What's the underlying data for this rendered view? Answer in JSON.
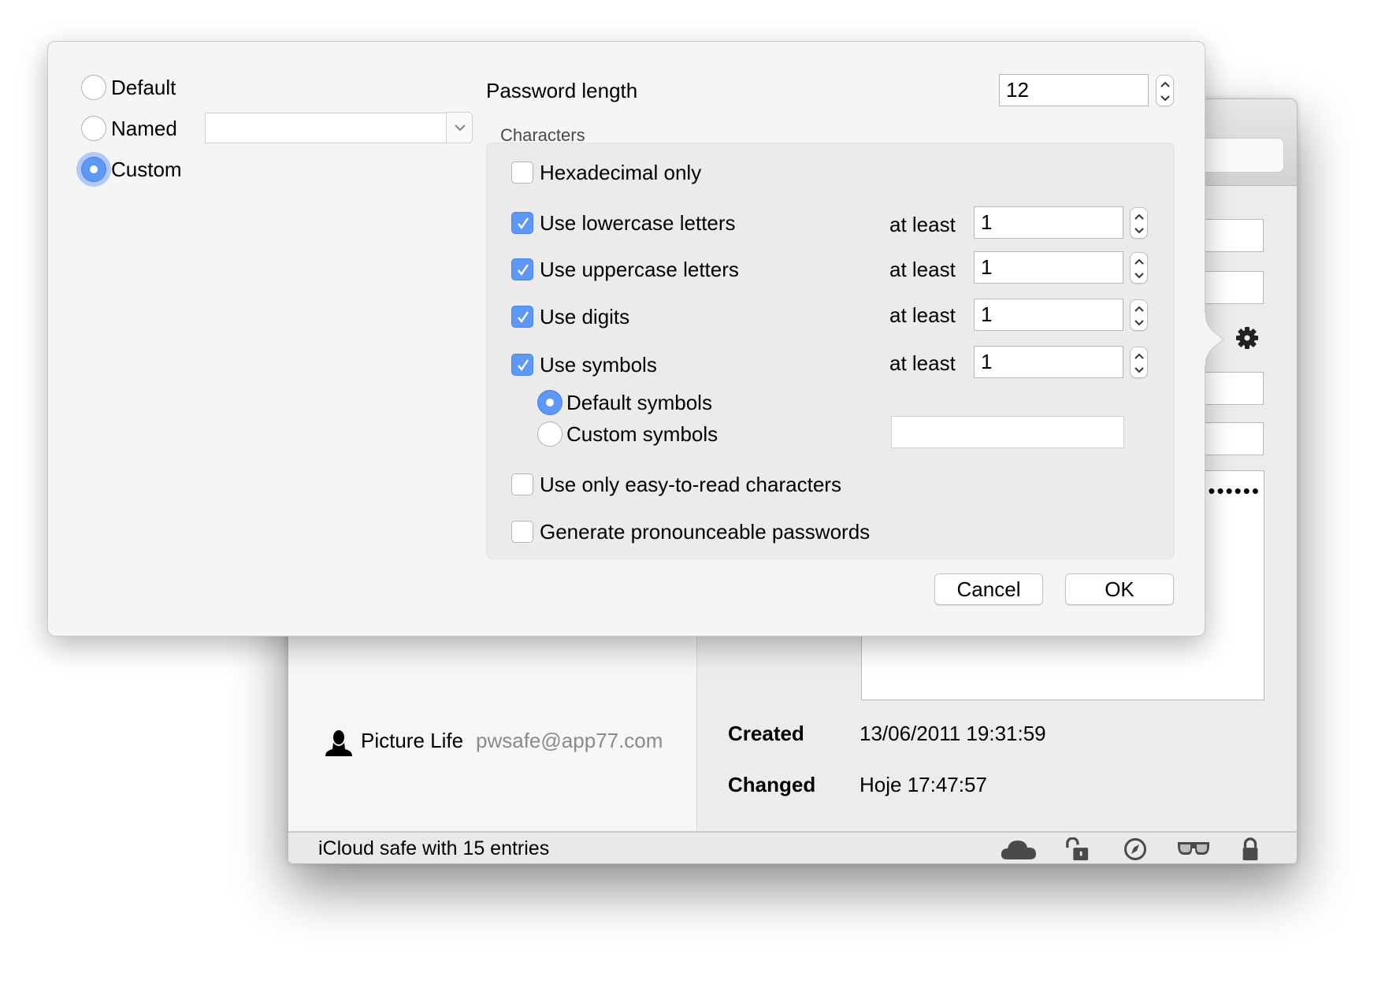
{
  "background_window": {
    "entry": {
      "icon": "person-icon",
      "name": "Picture Life",
      "username": "pwsafe@app77.com"
    },
    "password_mask": "••••••",
    "created_label": "Created",
    "created_value": "13/06/2011 19:31:59",
    "changed_label": "Changed",
    "changed_value": "Hoje 17:47:57",
    "status_text": "iCloud safe with 15 entries",
    "status_icons": [
      "cloud-icon",
      "unlock-icon",
      "compass-icon",
      "glasses-icon",
      "lock-icon"
    ],
    "gear_icon": "gear-icon"
  },
  "dialog": {
    "modes": [
      {
        "label": "Default",
        "selected": false
      },
      {
        "label": "Named",
        "selected": false
      },
      {
        "label": "Custom",
        "selected": true
      }
    ],
    "named_combo_value": "",
    "password_length_label": "Password length",
    "password_length_value": "12",
    "characters_group_title": "Characters",
    "options": {
      "hex_only": {
        "label": "Hexadecimal only",
        "checked": false
      },
      "lowercase": {
        "label": "Use lowercase letters",
        "checked": true,
        "at_least_label": "at least",
        "min": "1"
      },
      "uppercase": {
        "label": "Use uppercase letters",
        "checked": true,
        "at_least_label": "at least",
        "min": "1"
      },
      "digits": {
        "label": "Use digits",
        "checked": true,
        "at_least_label": "at least",
        "min": "1"
      },
      "symbols": {
        "label": "Use symbols",
        "checked": true,
        "at_least_label": "at least",
        "min": "1"
      },
      "default_symbols": {
        "label": "Default symbols",
        "selected": true
      },
      "custom_symbols": {
        "label": "Custom symbols",
        "selected": false,
        "value": ""
      },
      "easy_to_read": {
        "label": "Use only easy-to-read characters",
        "checked": false
      },
      "pronounceable": {
        "label": "Generate pronounceable passwords",
        "checked": false
      }
    },
    "cancel_label": "Cancel",
    "ok_label": "OK"
  },
  "colors": {
    "accent": "#5f97f5",
    "dialog_bg": "#f5f5f5",
    "group_bg": "#ebebeb",
    "icon_gray": "#4a4a4a"
  }
}
